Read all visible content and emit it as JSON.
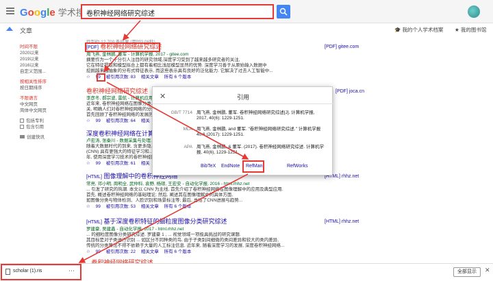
{
  "header": {
    "logo_google": "Google",
    "logo_scholar": "学术搜索",
    "search_value": "卷积神经网络研究综述"
  },
  "subheader": {
    "title": "文章",
    "my_profile": "我的个人学术档案",
    "my_library": "我的图书馆"
  },
  "results_count": "找到约 12,700 条结果 (用时0.06秒)",
  "sidebar": {
    "time": [
      "时间不限",
      "2020以来",
      "2019以来",
      "2016以来",
      "自定义范围..."
    ],
    "sort": [
      "按相关性排序",
      "按日期排序"
    ],
    "lang": [
      "不限语言",
      "中文网页",
      "简体中文网页"
    ],
    "include_patents": "包括专利",
    "include_citations": "包含引用",
    "create_alert": "创建快讯"
  },
  "results": [
    {
      "type": "[PDF]",
      "title": "卷积神经网络研究综述",
      "source": "周飞燕, 金林鹏, 董军 - 计算机学报, 2017 - gitee.com",
      "snippet": [
        "摘要作为一个十分引人注目的研究领域,深度学习受到了越来越多研究者的关注,",
        "它在特征提取和模型拟合上都有着相比浅层模型显然的优势. 深度学习善于从原始输入数据中",
        "挖掘越来越抽象的分布式特征表示, 而这些表示具有良好的泛化能力. 它解决了过去人工智能中..."
      ],
      "cited": "被引用次数: 83",
      "related": "相关文章",
      "versions": "所有 6 个版本",
      "side_link": "[PDF] gitee.com"
    },
    {
      "type": "",
      "title": "卷积神经网络研究综述",
      "source": "李彦冬, 郝宗波, 雷航 - 计算机应用, 2016",
      "snippet": [
        "近年来, 卷积神经网络在图像分类...",
        "关, 明确人们对卷积神经网络的分类特...",
        "首先回顾了卷积神经网络的发展历..."
      ],
      "cited": "被引用次数: 64",
      "related": "相关",
      "versions": "",
      "side_link": "[PDF] joca.cn"
    },
    {
      "type": "",
      "title": "深度卷积神经网络在计算机...",
      "source": "卢宏涛, 张秦川 - 数据采集与处理...",
      "snippet": [
        "随着大数据时代的到来, 含更多隐...",
        "(CNN) 具有更强大的特征学习和...",
        "年, 使用深度学习技术的卷积神经网..."
      ],
      "cited": "被引用次数: 61",
      "related": "相关",
      "versions": "",
      "side_link": ""
    },
    {
      "type": "[HTML]",
      "title": "图像理解中的卷积神经网络",
      "source": "常亮, 邓小明, 周明全, 武仲科, 袁野, 杨硕, 王宏安 - 自动化学报, 2016 - html.rhhz.net",
      "snippet": [
        "... 引发了研究的热潮. 本文以 CNN 为主线, 首先介绍了卷积神经网络在图像理解中的应用及典型应用.",
        "首先, 概述卷积神经网络的基础理论; 然后, 阐述其在图像理解中的具体方面,",
        "如图像分类与物体检测、人脸识别和场景标注等; 最后, 总结了CNN进展与趋势..."
      ],
      "cited": "被引用次数: 53",
      "related": "相关文章",
      "versions": "所有 6 个版本",
      "side_link": "[HTML] rhhz.net"
    },
    {
      "type": "[HTML]",
      "title": "基于深度卷积特征的细粒度图像分类研究综述",
      "source": "罗建豪, 吴建鑫 - 自动化学报, 2017 - html.rhhz.net",
      "snippet": [
        "... 的细粒度图像分类研究综述. 罗建豪 1 , ... 视觉领域一项极具挑战的研究课题.",
        "其目标是对子类进行识别 ... 如区分不同种类的鸟. 由于子类别间细微的类间差异和较大的类内差异,",
        "传统的分类算法不得不依赖于大量的人工标注信息. 近年来, 随着深度学习的发展, 深度卷积神经网络..."
      ],
      "cited": "被引用次数: 22",
      "related": "相关文章",
      "versions": "所有 6 个版本",
      "side_link": "[HTML] rhhz.net"
    }
  ],
  "last_result_partial": "...卷积神经网络研究综述",
  "dialog": {
    "title": "引用",
    "rows": [
      {
        "label": "GB/T 7714",
        "text": "周飞燕, 金林鹏, 董军. 卷积神经网络研究综述[J]. 计算机学报, 2017, 40(6): 1229-1251."
      },
      {
        "label": "MLA",
        "text": "周飞燕, 金林鹏, and 董军. \"卷积神经网络研究综述.\" 计算机学报 40.6 (2017): 1229-1251."
      },
      {
        "label": "APA",
        "text": "周飞燕, 金林鹏, & 董军. (2017). 卷积神经网络研究综述. 计算机学报, 40(6), 1229-1251."
      }
    ],
    "exports": [
      "BibTeX",
      "EndNote",
      "RefMan",
      "RefWorks"
    ]
  },
  "download_bar": {
    "file_name": "scholar (1).ris",
    "more": "⋯",
    "show_all": "全部显示",
    "close": "✕"
  },
  "colors": {
    "accent_red": "#e53935",
    "link_blue": "#1a0dab",
    "highlight_red": "#d93025",
    "source_green": "#006621"
  }
}
